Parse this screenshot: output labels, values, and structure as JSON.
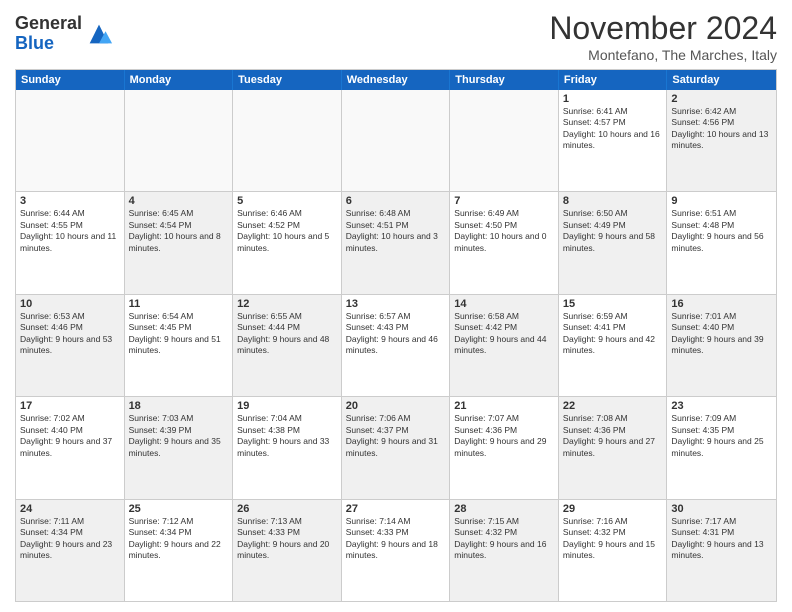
{
  "logo": {
    "general": "General",
    "blue": "Blue"
  },
  "title": "November 2024",
  "location": "Montefano, The Marches, Italy",
  "days_of_week": [
    "Sunday",
    "Monday",
    "Tuesday",
    "Wednesday",
    "Thursday",
    "Friday",
    "Saturday"
  ],
  "weeks": [
    [
      {
        "day": "",
        "info": "",
        "empty": true
      },
      {
        "day": "",
        "info": "",
        "empty": true
      },
      {
        "day": "",
        "info": "",
        "empty": true
      },
      {
        "day": "",
        "info": "",
        "empty": true
      },
      {
        "day": "",
        "info": "",
        "empty": true
      },
      {
        "day": "1",
        "info": "Sunrise: 6:41 AM\nSunset: 4:57 PM\nDaylight: 10 hours and 16 minutes."
      },
      {
        "day": "2",
        "info": "Sunrise: 6:42 AM\nSunset: 4:56 PM\nDaylight: 10 hours and 13 minutes.",
        "shaded": true
      }
    ],
    [
      {
        "day": "3",
        "info": "Sunrise: 6:44 AM\nSunset: 4:55 PM\nDaylight: 10 hours and 11 minutes."
      },
      {
        "day": "4",
        "info": "Sunrise: 6:45 AM\nSunset: 4:54 PM\nDaylight: 10 hours and 8 minutes.",
        "shaded": true
      },
      {
        "day": "5",
        "info": "Sunrise: 6:46 AM\nSunset: 4:52 PM\nDaylight: 10 hours and 5 minutes."
      },
      {
        "day": "6",
        "info": "Sunrise: 6:48 AM\nSunset: 4:51 PM\nDaylight: 10 hours and 3 minutes.",
        "shaded": true
      },
      {
        "day": "7",
        "info": "Sunrise: 6:49 AM\nSunset: 4:50 PM\nDaylight: 10 hours and 0 minutes."
      },
      {
        "day": "8",
        "info": "Sunrise: 6:50 AM\nSunset: 4:49 PM\nDaylight: 9 hours and 58 minutes.",
        "shaded": true
      },
      {
        "day": "9",
        "info": "Sunrise: 6:51 AM\nSunset: 4:48 PM\nDaylight: 9 hours and 56 minutes."
      }
    ],
    [
      {
        "day": "10",
        "info": "Sunrise: 6:53 AM\nSunset: 4:46 PM\nDaylight: 9 hours and 53 minutes.",
        "shaded": true
      },
      {
        "day": "11",
        "info": "Sunrise: 6:54 AM\nSunset: 4:45 PM\nDaylight: 9 hours and 51 minutes."
      },
      {
        "day": "12",
        "info": "Sunrise: 6:55 AM\nSunset: 4:44 PM\nDaylight: 9 hours and 48 minutes.",
        "shaded": true
      },
      {
        "day": "13",
        "info": "Sunrise: 6:57 AM\nSunset: 4:43 PM\nDaylight: 9 hours and 46 minutes."
      },
      {
        "day": "14",
        "info": "Sunrise: 6:58 AM\nSunset: 4:42 PM\nDaylight: 9 hours and 44 minutes.",
        "shaded": true
      },
      {
        "day": "15",
        "info": "Sunrise: 6:59 AM\nSunset: 4:41 PM\nDaylight: 9 hours and 42 minutes."
      },
      {
        "day": "16",
        "info": "Sunrise: 7:01 AM\nSunset: 4:40 PM\nDaylight: 9 hours and 39 minutes.",
        "shaded": true
      }
    ],
    [
      {
        "day": "17",
        "info": "Sunrise: 7:02 AM\nSunset: 4:40 PM\nDaylight: 9 hours and 37 minutes."
      },
      {
        "day": "18",
        "info": "Sunrise: 7:03 AM\nSunset: 4:39 PM\nDaylight: 9 hours and 35 minutes.",
        "shaded": true
      },
      {
        "day": "19",
        "info": "Sunrise: 7:04 AM\nSunset: 4:38 PM\nDaylight: 9 hours and 33 minutes."
      },
      {
        "day": "20",
        "info": "Sunrise: 7:06 AM\nSunset: 4:37 PM\nDaylight: 9 hours and 31 minutes.",
        "shaded": true
      },
      {
        "day": "21",
        "info": "Sunrise: 7:07 AM\nSunset: 4:36 PM\nDaylight: 9 hours and 29 minutes."
      },
      {
        "day": "22",
        "info": "Sunrise: 7:08 AM\nSunset: 4:36 PM\nDaylight: 9 hours and 27 minutes.",
        "shaded": true
      },
      {
        "day": "23",
        "info": "Sunrise: 7:09 AM\nSunset: 4:35 PM\nDaylight: 9 hours and 25 minutes."
      }
    ],
    [
      {
        "day": "24",
        "info": "Sunrise: 7:11 AM\nSunset: 4:34 PM\nDaylight: 9 hours and 23 minutes.",
        "shaded": true
      },
      {
        "day": "25",
        "info": "Sunrise: 7:12 AM\nSunset: 4:34 PM\nDaylight: 9 hours and 22 minutes."
      },
      {
        "day": "26",
        "info": "Sunrise: 7:13 AM\nSunset: 4:33 PM\nDaylight: 9 hours and 20 minutes.",
        "shaded": true
      },
      {
        "day": "27",
        "info": "Sunrise: 7:14 AM\nSunset: 4:33 PM\nDaylight: 9 hours and 18 minutes."
      },
      {
        "day": "28",
        "info": "Sunrise: 7:15 AM\nSunset: 4:32 PM\nDaylight: 9 hours and 16 minutes.",
        "shaded": true
      },
      {
        "day": "29",
        "info": "Sunrise: 7:16 AM\nSunset: 4:32 PM\nDaylight: 9 hours and 15 minutes."
      },
      {
        "day": "30",
        "info": "Sunrise: 7:17 AM\nSunset: 4:31 PM\nDaylight: 9 hours and 13 minutes.",
        "shaded": true
      }
    ]
  ]
}
